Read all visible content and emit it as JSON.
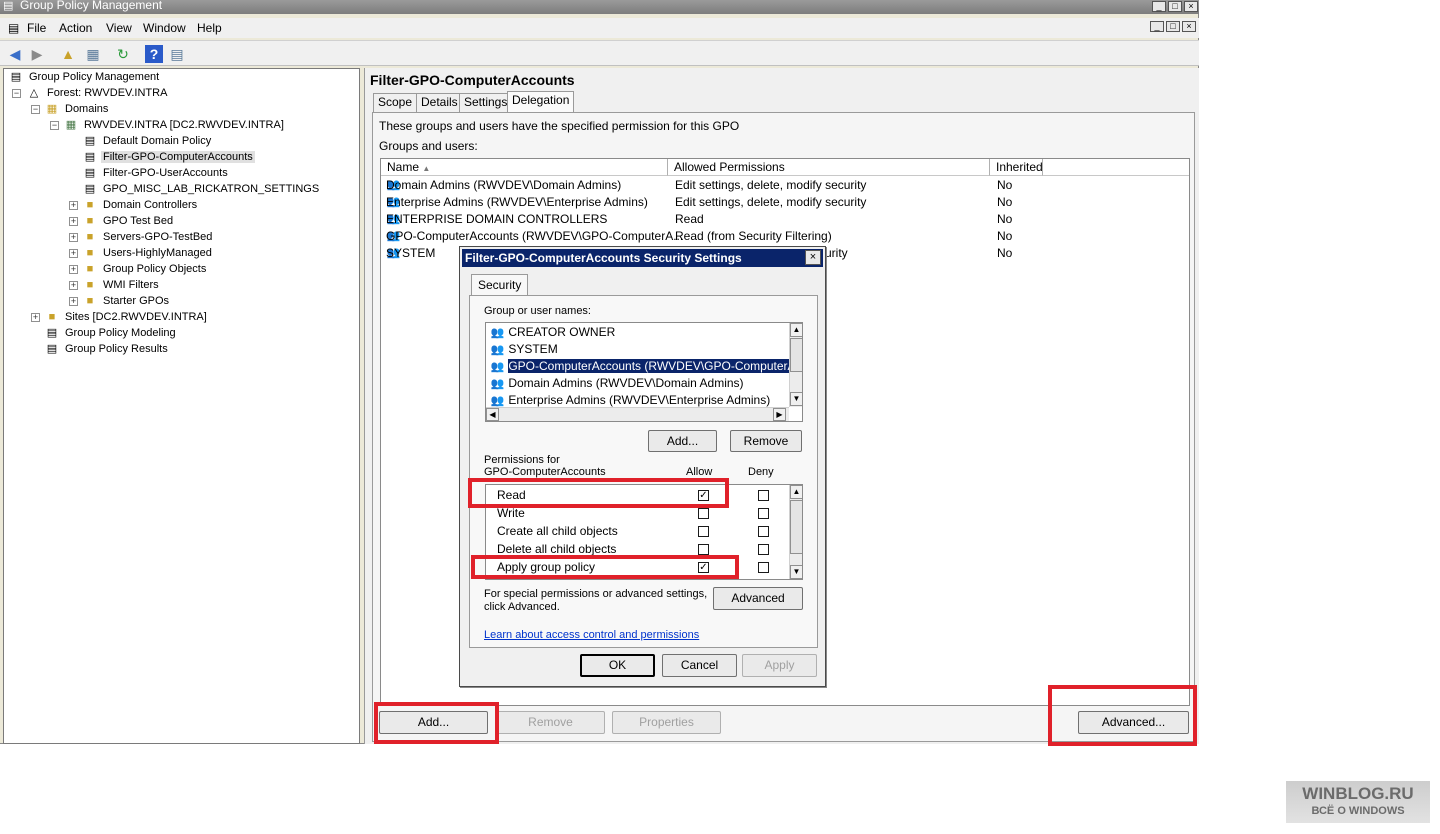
{
  "window": {
    "title": "Group Policy Management",
    "controls": [
      "_",
      "□",
      "×"
    ]
  },
  "menu": [
    "File",
    "Action",
    "View",
    "Window",
    "Help"
  ],
  "toolbar_icons": [
    "back-icon",
    "forward-icon",
    "up-folder-icon",
    "show-hide-tree-icon",
    "refresh-icon",
    "help-icon",
    "properties-icon"
  ],
  "tree": {
    "root": "Group Policy Management",
    "forest": "Forest: RWVDEV.INTRA",
    "domains": "Domains",
    "domain": "RWVDEV.INTRA [DC2.RWVDEV.INTRA]",
    "gpos": [
      "Default Domain Policy",
      "Filter-GPO-ComputerAccounts",
      "Filter-GPO-UserAccounts",
      "GPO_MISC_LAB_RICKATRON_SETTINGS"
    ],
    "ous": [
      "Domain Controllers",
      "GPO Test Bed",
      "Servers-GPO-TestBed",
      "Users-HighlyManaged",
      "Group Policy Objects",
      "WMI Filters",
      "Starter GPOs"
    ],
    "sites": "Sites [DC2.RWVDEV.INTRA]",
    "modeling": "Group Policy Modeling",
    "results": "Group Policy Results"
  },
  "details": {
    "title": "Filter-GPO-ComputerAccounts",
    "tabs": [
      "Scope",
      "Details",
      "Settings",
      "Delegation"
    ],
    "active_tab": "Delegation",
    "description": "These groups and users have the specified permission for this GPO",
    "groups_label": "Groups and users:",
    "columns": [
      "Name",
      "Allowed Permissions",
      "Inherited"
    ],
    "rows": [
      {
        "name": "Domain Admins (RWVDEV\\Domain Admins)",
        "perm": "Edit settings, delete, modify security",
        "inh": "No"
      },
      {
        "name": "Enterprise Admins (RWVDEV\\Enterprise Admins)",
        "perm": "Edit settings, delete, modify security",
        "inh": "No"
      },
      {
        "name": "ENTERPRISE DOMAIN CONTROLLERS",
        "perm": "Read",
        "inh": "No"
      },
      {
        "name": "GPO-ComputerAccounts (RWVDEV\\GPO-ComputerA...",
        "perm": "Read (from Security Filtering)",
        "inh": "No"
      },
      {
        "name": "SYSTEM",
        "perm": "urity",
        "inh": "No"
      }
    ],
    "buttons": {
      "add": "Add...",
      "remove": "Remove",
      "properties": "Properties",
      "advanced": "Advanced..."
    }
  },
  "dialog": {
    "title": "Filter-GPO-ComputerAccounts Security Settings",
    "close": "×",
    "tab": "Security",
    "group_label": "Group or user names:",
    "users": [
      "CREATOR OWNER",
      "SYSTEM",
      "GPO-ComputerAccounts (RWVDEV\\GPO-ComputerAccou",
      "Domain Admins (RWVDEV\\Domain Admins)",
      "Enterprise Admins (RWVDEV\\Enterprise Admins)"
    ],
    "selected_user_index": 2,
    "add": "Add...",
    "remove": "Remove",
    "perm_label_1": "Permissions for",
    "perm_label_2": "GPO-ComputerAccounts",
    "allow": "Allow",
    "deny": "Deny",
    "permissions": [
      {
        "name": "Read",
        "allow": true,
        "deny": false
      },
      {
        "name": "Write",
        "allow": false,
        "deny": false
      },
      {
        "name": "Create all child objects",
        "allow": false,
        "deny": false
      },
      {
        "name": "Delete all child objects",
        "allow": false,
        "deny": false
      },
      {
        "name": "Apply group policy",
        "allow": true,
        "deny": false
      }
    ],
    "special_1": "For special permissions or advanced settings,",
    "special_2": "click Advanced.",
    "advanced": "Advanced",
    "learn_link": "Learn about access control and permissions",
    "ok": "OK",
    "cancel": "Cancel",
    "apply": "Apply"
  },
  "watermark": {
    "line1": "WINBLOG.RU",
    "line2": "ВСЁ О WINDOWS"
  },
  "colors": {
    "highlight": "#e0212a",
    "selection": "#0a246a",
    "link": "#0033cc"
  }
}
